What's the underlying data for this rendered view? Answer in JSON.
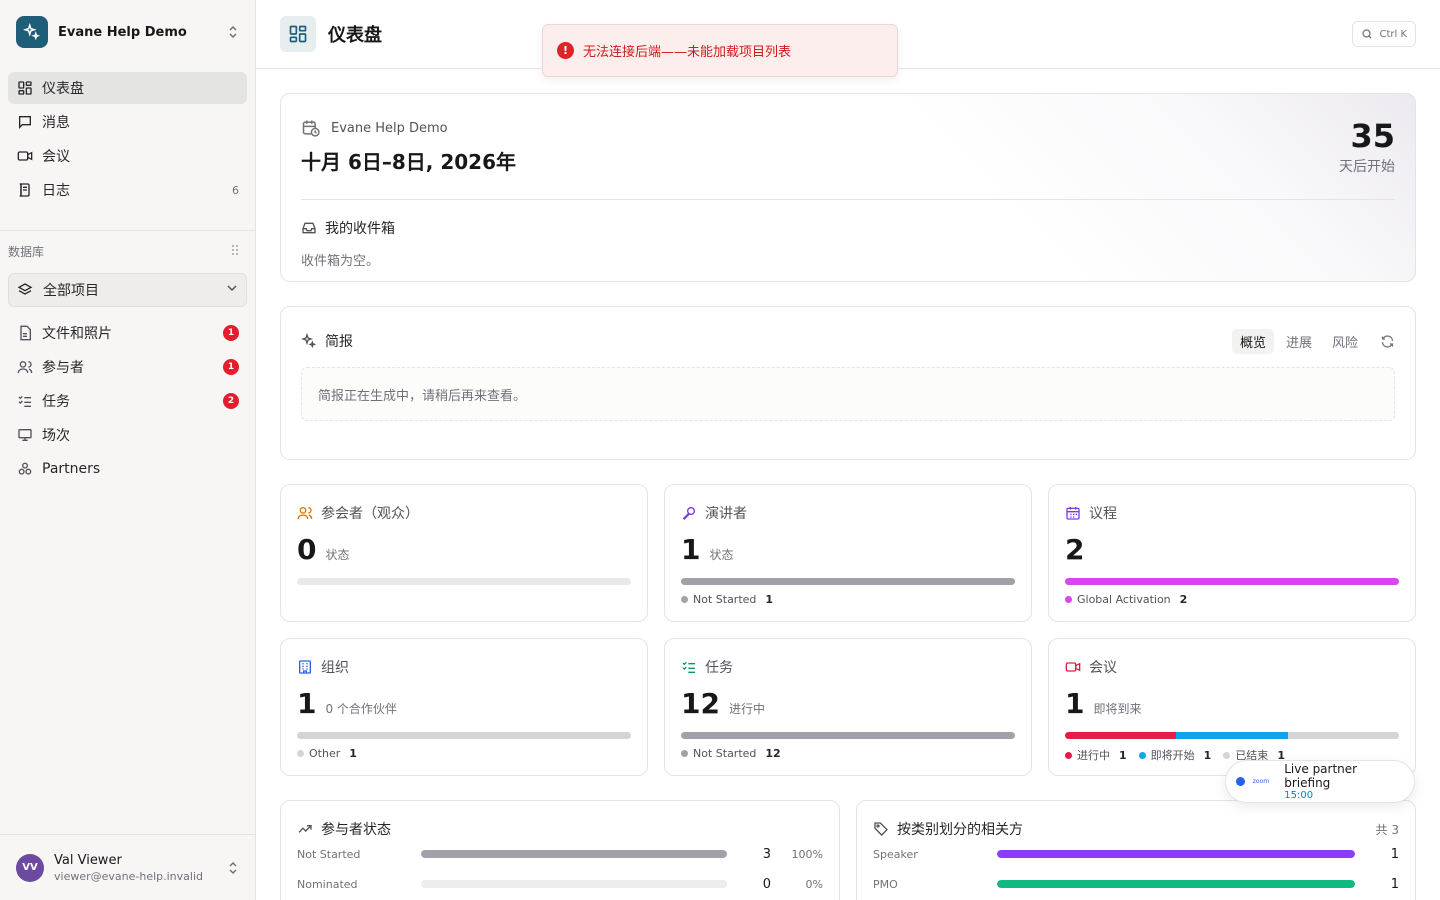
{
  "app": {
    "name": "Evane Help Demo"
  },
  "nav": [
    {
      "label": "仪表盘",
      "icon": "grid-icon",
      "active": true
    },
    {
      "label": "消息",
      "icon": "message-icon"
    },
    {
      "label": "会议",
      "icon": "video-icon"
    },
    {
      "label": "日志",
      "icon": "log-icon",
      "count": "6"
    }
  ],
  "database": {
    "section_label": "数据库",
    "select_label": "全部项目",
    "items": [
      {
        "label": "文件和照片",
        "badge": "1"
      },
      {
        "label": "参与者",
        "badge": "1"
      },
      {
        "label": "任务",
        "badge": "2"
      },
      {
        "label": "场次"
      },
      {
        "label": "Partners"
      }
    ]
  },
  "user": {
    "initials": "VV",
    "name": "Val Viewer",
    "email": "viewer@evane-help.invalid"
  },
  "header": {
    "title": "仪表盘",
    "shortcut": "Ctrl K"
  },
  "toast": {
    "message": "无法连接后端——未能加载项目列表"
  },
  "event": {
    "name": "Evane Help Demo",
    "dates": "十月 6日–8日, 2026年",
    "countdown": "35",
    "countdown_label": "天后开始",
    "inbox_title": "我的收件箱",
    "inbox_empty": "收件箱为空。"
  },
  "brief": {
    "title": "简报",
    "tabs": [
      "概览",
      "进展",
      "风险"
    ],
    "active_tab": 0,
    "message": "简报正在生成中，请稍后再来查看。"
  },
  "stats": {
    "attendees": {
      "title": "参会者（观众）",
      "value": "0",
      "unit": "状态"
    },
    "speakers": {
      "title": "演讲者",
      "value": "1",
      "unit": "状态",
      "legend": [
        {
          "label": "Not Started",
          "count": "1",
          "color": "#a1a1aa"
        }
      ]
    },
    "agenda": {
      "title": "议程",
      "value": "2",
      "legend": [
        {
          "label": "Global Activation",
          "count": "2",
          "color": "#d946ef"
        }
      ]
    },
    "orgs": {
      "title": "组织",
      "value": "1",
      "unit": "0 个合作伙伴",
      "legend": [
        {
          "label": "Other",
          "count": "1",
          "color": "#d4d4d8"
        }
      ]
    },
    "tasks": {
      "title": "任务",
      "value": "12",
      "unit": "进行中",
      "legend": [
        {
          "label": "Not Started",
          "count": "12",
          "color": "#a1a1aa"
        }
      ]
    },
    "meetings": {
      "title": "会议",
      "value": "1",
      "unit": "即将到来",
      "legend": [
        {
          "label": "进行中",
          "count": "1",
          "color": "#e11d48"
        },
        {
          "label": "即将开始",
          "count": "1",
          "color": "#0ea5e9"
        },
        {
          "label": "已结束",
          "count": "1",
          "color": "#d4d4d8"
        }
      ]
    }
  },
  "participant_status": {
    "title": "参与者状态",
    "rows": [
      {
        "label": "Not Started",
        "count": "3",
        "pct": "100%",
        "fill": 1.0,
        "color": "#a1a1aa"
      },
      {
        "label": "Nominated",
        "count": "0",
        "pct": "0%",
        "fill": 0.0,
        "color": "#a1a1aa"
      }
    ]
  },
  "stakeholders": {
    "title": "按类别划分的相关方",
    "total": "共 3",
    "rows": [
      {
        "label": "Speaker",
        "count": "1",
        "fill": 1.0,
        "color": "#8b3cf6"
      },
      {
        "label": "PMO",
        "count": "1",
        "fill": 1.0,
        "color": "#10b981"
      }
    ]
  },
  "zoom_popup": {
    "brand": "zoom",
    "title": "Live partner briefing",
    "time": "15:00"
  }
}
